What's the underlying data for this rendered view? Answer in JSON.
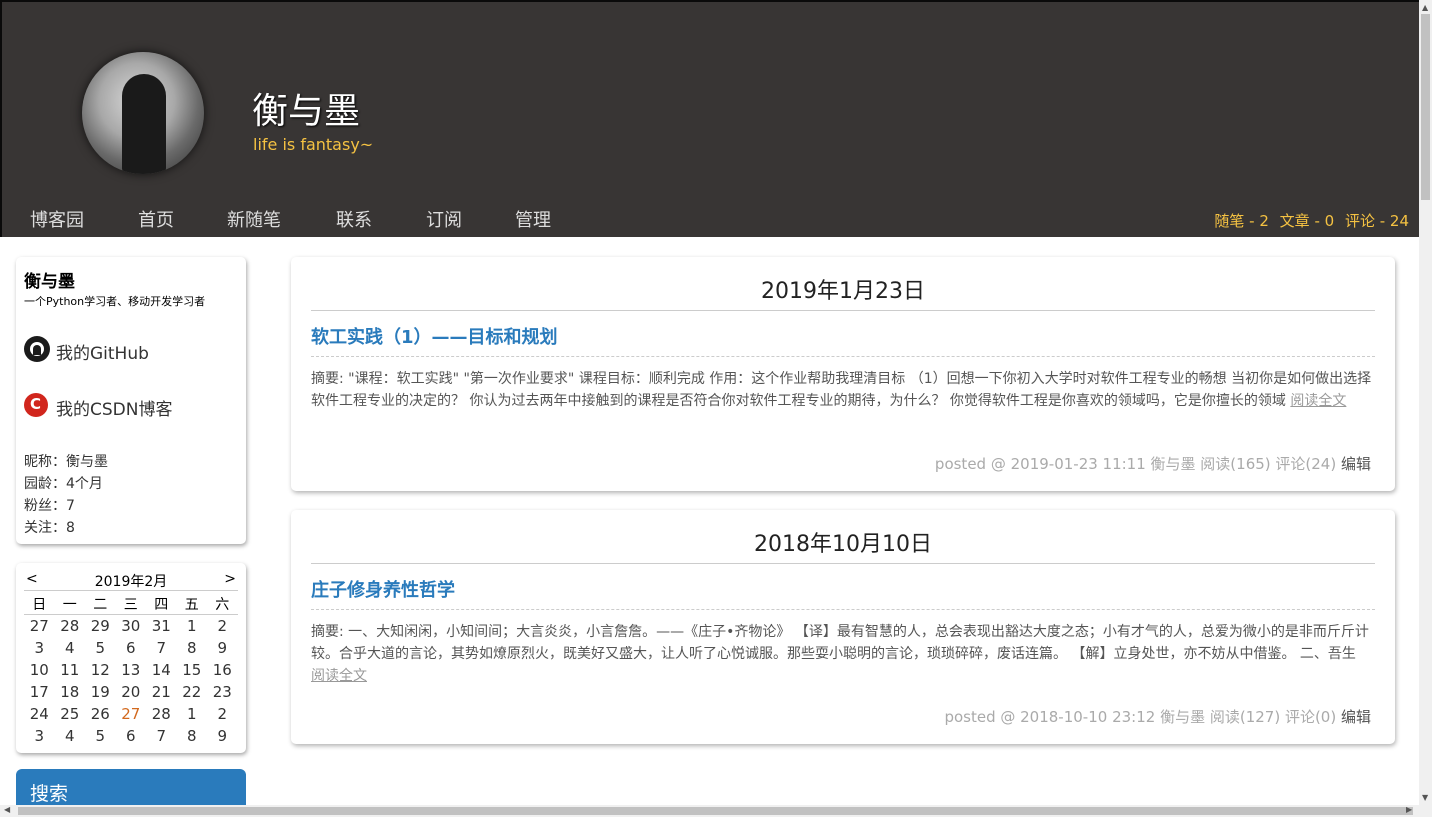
{
  "header": {
    "title": "衡与墨",
    "subtitle": "life is fantasy~",
    "nav": [
      "博客园",
      "首页",
      "新随笔",
      "联系",
      "订阅",
      "管理"
    ],
    "stats": {
      "posts": "随笔 - 2",
      "articles": "文章 - 0",
      "comments": "评论 - 24"
    }
  },
  "sidebar": {
    "profile": {
      "name": "衡与墨",
      "description": "一个Python学习者、移动开发学习者",
      "github_link": "我的GitHub",
      "csdn_link": "我的CSDN博客",
      "nickname": "昵称：衡与墨",
      "age": "园龄：4个月",
      "fans": "粉丝：7",
      "follow": "关注：8"
    },
    "calendar": {
      "prev": "<",
      "next": ">",
      "title": "2019年2月",
      "weekdays": [
        "日",
        "一",
        "二",
        "三",
        "四",
        "五",
        "六"
      ],
      "weeks": [
        [
          "27",
          "28",
          "29",
          "30",
          "31",
          "1",
          "2"
        ],
        [
          "3",
          "4",
          "5",
          "6",
          "7",
          "8",
          "9"
        ],
        [
          "10",
          "11",
          "12",
          "13",
          "14",
          "15",
          "16"
        ],
        [
          "17",
          "18",
          "19",
          "20",
          "21",
          "22",
          "23"
        ],
        [
          "24",
          "25",
          "26",
          "27",
          "28",
          "1",
          "2"
        ],
        [
          "3",
          "4",
          "5",
          "6",
          "7",
          "8",
          "9"
        ]
      ],
      "today": "27"
    },
    "search": {
      "title": "搜索"
    }
  },
  "posts": [
    {
      "date": "2019年1月23日",
      "title": "软工实践（1）——目标和规划",
      "summary": "摘要: \"课程：软工实践\" \"第一次作业要求\" 课程目标：顺利完成 作用：这个作业帮助我理清目标 （1）回想一下你初入大学时对软件工程专业的畅想 当初你是如何做出选择软件工程专业的决定的？ 你认为过去两年中接触到的课程是否符合你对软件工程专业的期待，为什么？ 你觉得软件工程是你喜欢的领域吗，它是你擅长的领域",
      "read_more": "阅读全文",
      "meta": "posted @ 2019-01-23 11:11 衡与墨 阅读(165) 评论(24)",
      "edit": "编辑"
    },
    {
      "date": "2018年10月10日",
      "title": "庄子修身养性哲学",
      "summary": "摘要: 一、大知闲闲，小知间间；大言炎炎，小言詹詹。——《庄子•齐物论》 【译】最有智慧的人，总会表现出豁达大度之态；小有才气的人，总爱为微小的是非而斤斤计较。合乎大道的言论，其势如燎原烈火，既美好又盛大，让人听了心悦诚服。那些耍小聪明的言论，琐琐碎碎，废话连篇。 【解】立身处世，亦不妨从中借鉴。 二、吾生",
      "read_more": "阅读全文",
      "meta": "posted @ 2018-10-10 23:12 衡与墨 阅读(127) 评论(0)",
      "edit": "编辑"
    }
  ],
  "colors": {
    "header_bg": "#383534",
    "accent_yellow": "#f5c242",
    "link_blue": "#2a7bbc",
    "today_orange": "#d2691e"
  }
}
